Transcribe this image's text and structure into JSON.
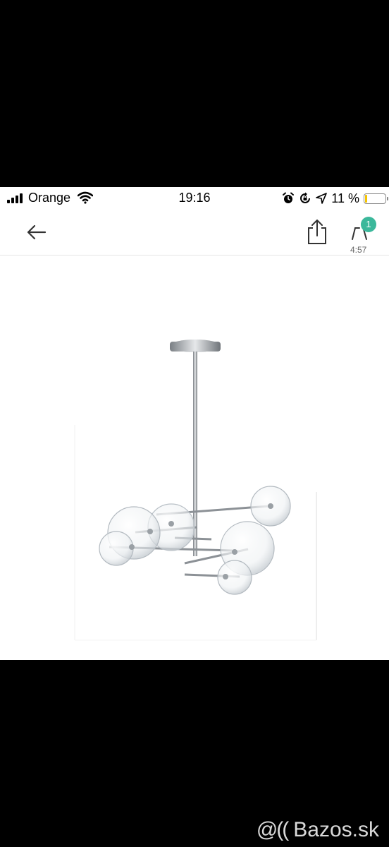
{
  "status_bar": {
    "carrier": "Orange",
    "time": "19:16",
    "battery_percent": "11 %",
    "battery_level": 0.11,
    "icons": [
      "signal-icon",
      "wifi-icon",
      "alarm-icon",
      "rotation-lock-icon",
      "location-icon",
      "battery-icon"
    ]
  },
  "nav": {
    "cart_badge": "1",
    "cart_timer": "4:57",
    "icons": [
      "back-arrow-icon",
      "share-icon",
      "cart-icon"
    ]
  },
  "colors": {
    "accent": "#3bb89b",
    "battery_low": "#f5c400",
    "background": "#000000"
  },
  "watermark": {
    "logo": "@((",
    "text": "Bazos.sk"
  }
}
